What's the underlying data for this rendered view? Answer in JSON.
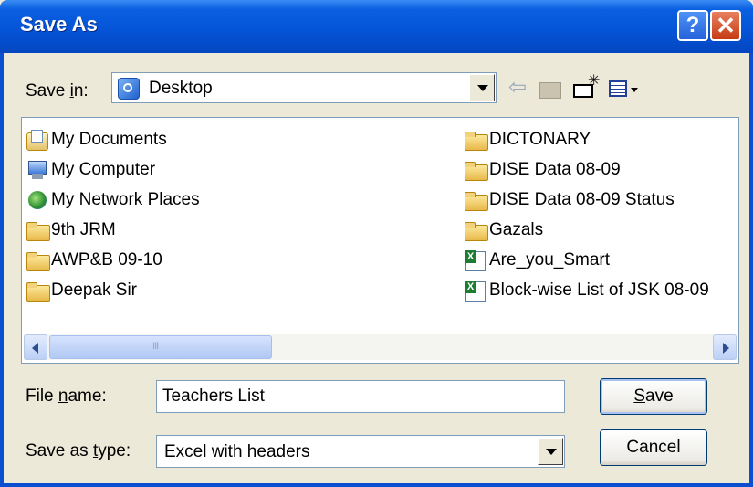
{
  "window": {
    "title": "Save As",
    "help_glyph": "?",
    "close_glyph": "✕"
  },
  "toolbar": {
    "save_in_prefix": "Save ",
    "save_in_underlined": "i",
    "save_in_suffix": "n:",
    "location": "Desktop",
    "back_glyph": "⇦"
  },
  "files": {
    "left_column": [
      {
        "name": "My Documents",
        "icon": "my-documents-icon"
      },
      {
        "name": "My Computer",
        "icon": "my-computer-icon"
      },
      {
        "name": "My Network Places",
        "icon": "network-places-icon"
      },
      {
        "name": "9th JRM",
        "icon": "folder-icon"
      },
      {
        "name": "AWP&B 09-10",
        "icon": "folder-icon"
      },
      {
        "name": "Deepak Sir",
        "icon": "folder-icon"
      }
    ],
    "right_column": [
      {
        "name": "DICTONARY",
        "icon": "folder-icon"
      },
      {
        "name": "DISE Data 08-09",
        "icon": "folder-icon"
      },
      {
        "name": "DISE Data 08-09 Status",
        "icon": "folder-icon"
      },
      {
        "name": "Gazals",
        "icon": "folder-icon"
      },
      {
        "name": "Are_you_Smart",
        "icon": "excel-file-icon"
      },
      {
        "name": "Block-wise List of JSK 08-09",
        "icon": "excel-file-icon"
      }
    ]
  },
  "form": {
    "filename_label_prefix": "File ",
    "filename_label_underlined": "n",
    "filename_label_suffix": "ame:",
    "filename_value": "Teachers List",
    "savetype_label_prefix": "Save as ",
    "savetype_label_underlined": "t",
    "savetype_label_suffix": "ype:",
    "savetype_value": "Excel with headers"
  },
  "buttons": {
    "save_underlined": "S",
    "save_rest": "ave",
    "cancel": "Cancel"
  },
  "colors": {
    "titlebar": "#0553D6",
    "dialog_bg": "#ECE9D8",
    "close": "#C53B14"
  }
}
